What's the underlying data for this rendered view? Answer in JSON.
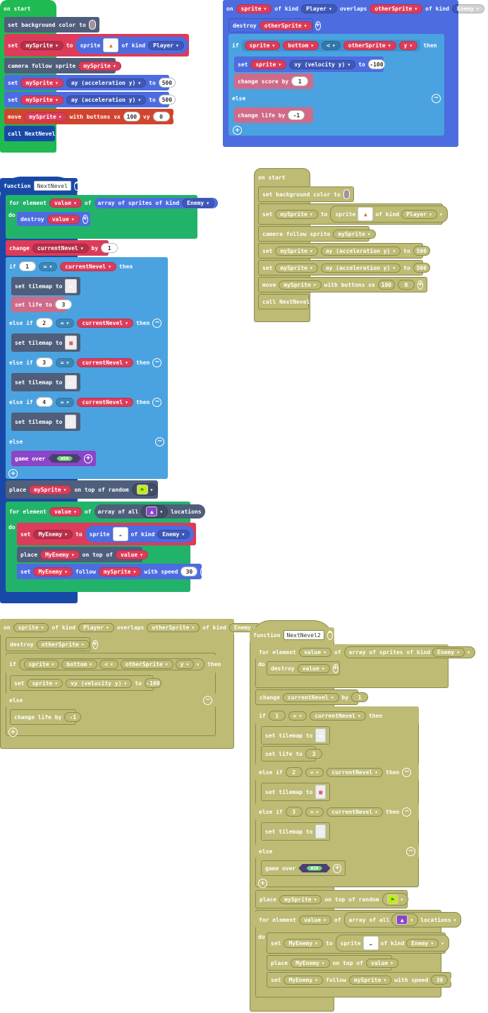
{
  "colors": {
    "events": "#1fba52",
    "sprites": "#4c6ce0",
    "variables": "#dd3b5a",
    "scene": "#4f5e7a",
    "functions": "#1849a8",
    "logic": "#4aa3e0",
    "info": "#ce6b88",
    "loops": "#22b36a",
    "game": "#8b45c9",
    "controller": "#d1442e",
    "disabled": "#bdbb74"
  },
  "on_start": {
    "hat": "on start",
    "bg_label": "set background color to",
    "set": "set",
    "to": "to",
    "sprite": "sprite",
    "of_kind": "of kind",
    "my_sprite": "mySprite",
    "player": "Player",
    "camera": "camera follow sprite",
    "ay": "ay (acceleration y)",
    "v500": "500",
    "move": "move",
    "buttons_vx": "with buttons vx",
    "vx": "100",
    "vy_label": "vy",
    "vy": "0",
    "call": "call NextNevel"
  },
  "overlap": {
    "on": "on",
    "sprite": "sprite",
    "of_kind": "of kind",
    "player": "Player",
    "overlaps": "overlaps",
    "other": "otherSprite",
    "enemy": "Enemy",
    "destroy": "destroy",
    "if": "if",
    "bottom": "bottom",
    "lt": "<",
    "y": "y",
    "then": "then",
    "set": "set",
    "vy": "vy (velocity y)",
    "to": "to",
    "vneg": "-100",
    "change_score": "change score by",
    "one": "1",
    "else": "else",
    "change_life": "change life by",
    "neg1": "-1"
  },
  "func": {
    "function": "function",
    "name": "NextNevel",
    "name2": "NextNevel2",
    "for_element": "for element",
    "value": "value",
    "of": "of",
    "array_kind": "array of sprites of kind",
    "enemy": "Enemy",
    "do": "do",
    "destroy": "destroy",
    "change": "change",
    "current": "currentNevel",
    "by": "by",
    "one": "1",
    "if": "if",
    "eq": "=",
    "then": "then",
    "set_tilemap": "set tilemap to",
    "set_life": "set life to",
    "three": "3",
    "else_if": "else if",
    "two": "2",
    "four": "4",
    "else": "else",
    "game_over": "game over",
    "win": "WIN",
    "place": "place",
    "my_sprite": "mySprite",
    "on_top_random": "on top of random",
    "array_all": "array of all",
    "locations": "locations",
    "set": "set",
    "my_enemy": "MyEnemy",
    "to": "to",
    "sprite": "sprite",
    "of_kind": "of kind",
    "on_top_of": "on top of",
    "follow": "follow",
    "with_speed": "with speed",
    "speed": "30"
  }
}
